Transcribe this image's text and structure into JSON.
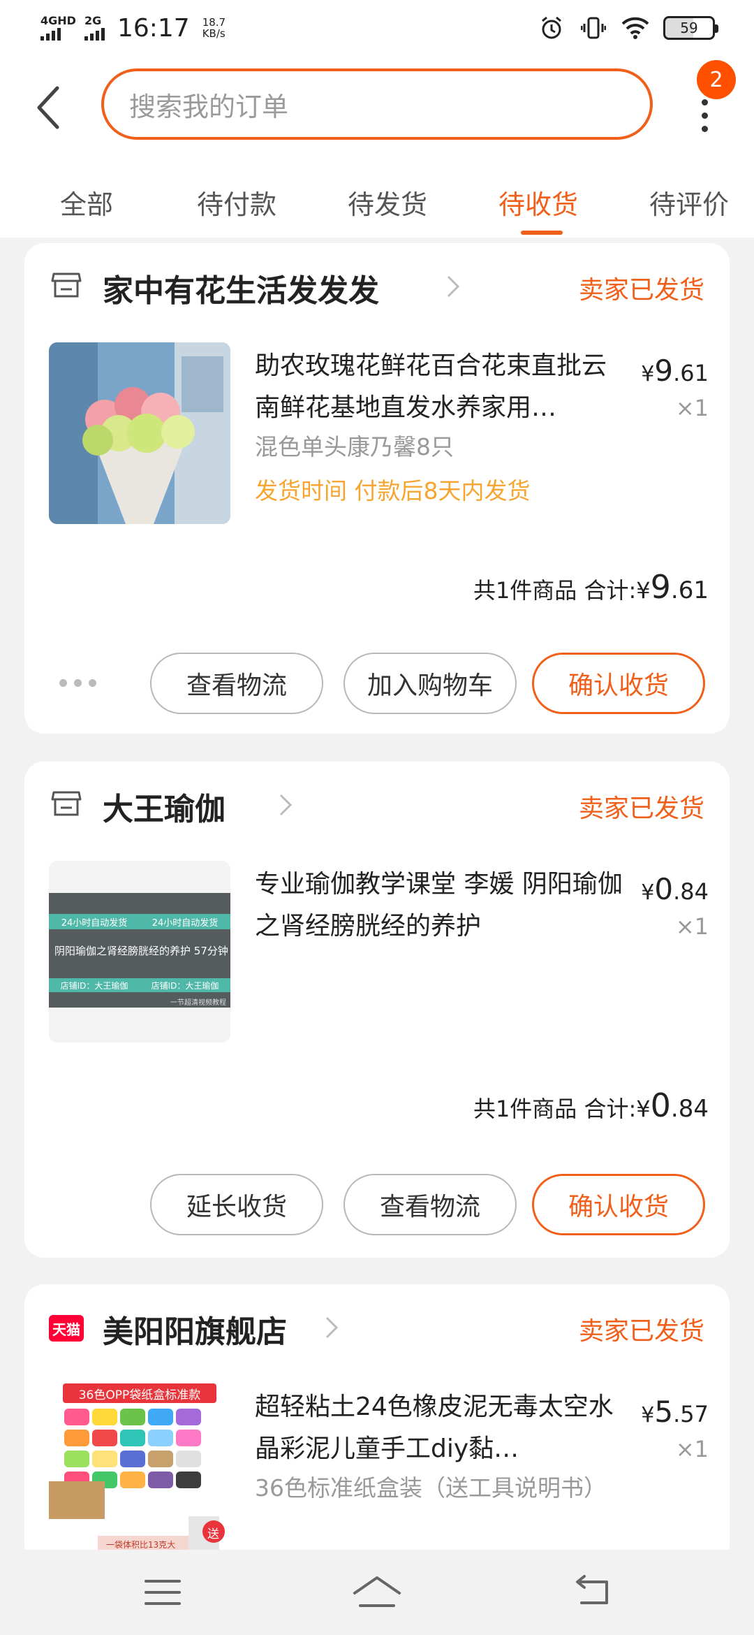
{
  "status_bar": {
    "sim1_label": "4GHD",
    "sim2_label": "2G",
    "time": "16:17",
    "net_speed_value": "18.7",
    "net_speed_unit": "KB/s",
    "battery_level": "59",
    "icons": [
      "alarm-icon",
      "vibrate-icon",
      "wifi-icon",
      "battery-icon"
    ]
  },
  "header": {
    "search_placeholder": "搜索我的订单",
    "notification_count": "2"
  },
  "tabs": [
    {
      "label": "全部",
      "active": false
    },
    {
      "label": "待付款",
      "active": false
    },
    {
      "label": "待发货",
      "active": false
    },
    {
      "label": "待收货",
      "active": true
    },
    {
      "label": "待评价",
      "active": false
    }
  ],
  "orders": [
    {
      "shop_icon": "shop-icon",
      "shop_name": "家中有花生活发发发",
      "status": "卖家已发货",
      "product_title": "助农玫瑰花鲜花百合花束直批云南鲜花基地直发水养家用…",
      "spec": "混色单头康乃馨8只",
      "ship_time": "发货时间 付款后8天内发货",
      "price_symbol": "¥",
      "price_int": "9",
      "price_dec": ".61",
      "qty": "×1",
      "summary_count": "共1件商品",
      "summary_label": "合计:",
      "total_int": "9",
      "total_dec": ".61",
      "buttons": [
        "查看物流",
        "加入购物车",
        "确认收货"
      ]
    },
    {
      "shop_icon": "shop-icon",
      "shop_name": "大王瑜伽",
      "status": "卖家已发货",
      "product_title": "专业瑜伽教学课堂 李媛 阴阳瑜伽之肾经膀胱经的养护",
      "image_text": {
        "line1a": "24小时自动发货",
        "line1b": "24小时自动发货",
        "caption": "阴阳瑜伽之肾经膀胱经的养护 57分钟",
        "line3a": "店铺ID：大王瑜伽",
        "line3b": "店铺ID：大王瑜伽",
        "watermark": "一节超清视频教程"
      },
      "price_symbol": "¥",
      "price_int": "0",
      "price_dec": ".84",
      "qty": "×1",
      "summary_count": "共1件商品",
      "summary_label": "合计:",
      "total_int": "0",
      "total_dec": ".84",
      "buttons": [
        "延长收货",
        "查看物流",
        "确认收货"
      ]
    },
    {
      "shop_icon": "tmall-icon",
      "shop_badge": "天猫",
      "shop_name": "美阳阳旗舰店",
      "status": "卖家已发货",
      "product_title": "超轻粘土24色橡皮泥无毒太空水晶彩泥儿童手工diy黏…",
      "spec": "36色标准纸盒装（送工具说明书）",
      "image_text": {
        "banner": "36色OPP袋纸盒标准款",
        "tag": "一袋体积比13克大",
        "gift": "送"
      },
      "price_symbol": "¥",
      "price_int": "5",
      "price_dec": ".57",
      "qty": "×1"
    }
  ],
  "colors": {
    "accent": "#f0601a",
    "ship_time": "#f7a531",
    "badge": "#ff5000",
    "tmall": "#ff0036"
  },
  "bottom_nav": [
    "menu-icon",
    "home-icon",
    "back-icon"
  ]
}
